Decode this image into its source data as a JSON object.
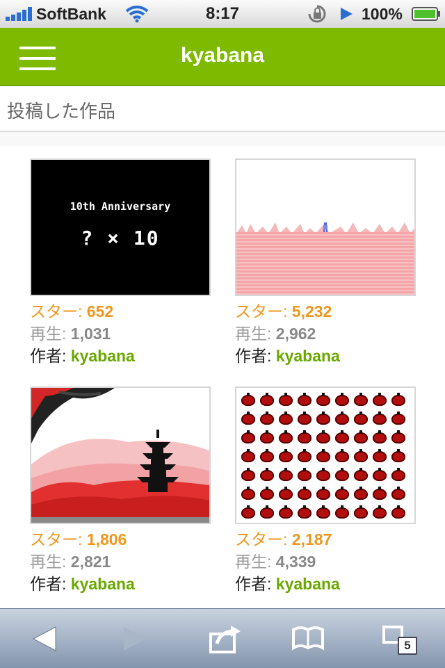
{
  "status_bar": {
    "carrier": "SoftBank",
    "time": "8:17",
    "battery_percent": "100%",
    "icons": [
      "signal-icon",
      "wifi-icon",
      "rotation-lock-icon",
      "play-icon",
      "battery-icon"
    ]
  },
  "header": {
    "title": "kyabana",
    "menu_icon": "hamburger-menu-icon",
    "accent_color": "#7dba00"
  },
  "section": {
    "title": "投稿した作品"
  },
  "works": [
    {
      "thumbnail_text_line1": "10th Anniversary",
      "thumbnail_text_line2": "? × 10",
      "star_label": "スター: ",
      "star": "652",
      "play_label": "再生: ",
      "plays": "1,031",
      "author_label": "作者: ",
      "author": "kyabana"
    },
    {
      "star_label": "スター: ",
      "star": "5,232",
      "play_label": "再生: ",
      "plays": "2,962",
      "author_label": "作者: ",
      "author": "kyabana"
    },
    {
      "star_label": "スター: ",
      "star": "1,806",
      "play_label": "再生: ",
      "plays": "2,821",
      "author_label": "作者: ",
      "author": "kyabana"
    },
    {
      "star_label": "スター: ",
      "star": "2,187",
      "play_label": "再生: ",
      "plays": "4,339",
      "author_label": "作者: ",
      "author": "kyabana"
    }
  ],
  "toolbar": {
    "tab_count": "5",
    "icons": [
      "back-icon",
      "forward-icon",
      "share-icon",
      "bookmarks-icon",
      "tabs-icon"
    ]
  },
  "colors": {
    "star": "#f0961e",
    "author": "#6aa800",
    "plays": "#888888"
  }
}
